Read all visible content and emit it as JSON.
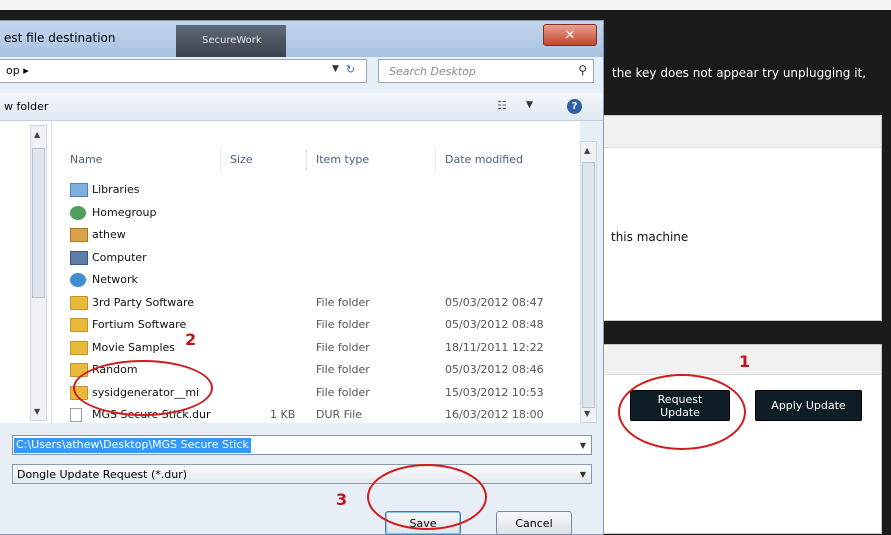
{
  "background_app": {
    "header_text": "the key does not appear try unplugging it,",
    "machine_text": "this machine",
    "request_update_label": "Request Update",
    "apply_update_label": "Apply Update"
  },
  "dialog": {
    "title": "est file destination",
    "secure_tab_label": "SecureWork",
    "close_label": "✕",
    "address": "op ▸",
    "search_placeholder": "Search Desktop",
    "new_folder_label": "w folder",
    "help_label": "?",
    "columns": {
      "name": "Name",
      "size": "Size",
      "type": "Item type",
      "date": "Date modified"
    },
    "items": [
      {
        "icon": "libraries-icon",
        "name": "Libraries",
        "size": "",
        "type": "",
        "date": ""
      },
      {
        "icon": "homegroup-icon",
        "name": "Homegroup",
        "size": "",
        "type": "",
        "date": ""
      },
      {
        "icon": "user-folder-icon",
        "name": "athew",
        "size": "",
        "type": "",
        "date": ""
      },
      {
        "icon": "computer-icon",
        "name": "Computer",
        "size": "",
        "type": "",
        "date": ""
      },
      {
        "icon": "network-icon",
        "name": "Network",
        "size": "",
        "type": "",
        "date": ""
      },
      {
        "icon": "folder-icon",
        "name": "3rd Party Software",
        "size": "",
        "type": "File folder",
        "date": "05/03/2012 08:47"
      },
      {
        "icon": "folder-icon",
        "name": "Fortium Software",
        "size": "",
        "type": "File folder",
        "date": "05/03/2012 08:48"
      },
      {
        "icon": "folder-icon",
        "name": "Movie Samples",
        "size": "",
        "type": "File folder",
        "date": "18/11/2011 12:22"
      },
      {
        "icon": "folder-icon",
        "name": "Random",
        "size": "",
        "type": "File folder",
        "date": "05/03/2012 08:46"
      },
      {
        "icon": "folder-icon",
        "name": "sysidgenerator__mi",
        "size": "",
        "type": "File folder",
        "date": "15/03/2012 10:53"
      },
      {
        "icon": "file-icon",
        "name": "MGS Secure Stick.dur",
        "size": "1 KB",
        "type": "DUR File",
        "date": "16/03/2012 18:00"
      }
    ],
    "file_name_value": "C:\\Users\\athew\\Desktop\\MGS Secure Stick",
    "file_type_value": "Dongle Update Request (*.dur)",
    "save_label": "Save",
    "cancel_label": "Cancel"
  },
  "annotations": {
    "step1": "1",
    "step2": "2",
    "step3": "3"
  },
  "colors": {
    "annotation_red": "#d01c1c",
    "dark_button": "#0f1d26",
    "selection_blue": "#3399ff"
  }
}
